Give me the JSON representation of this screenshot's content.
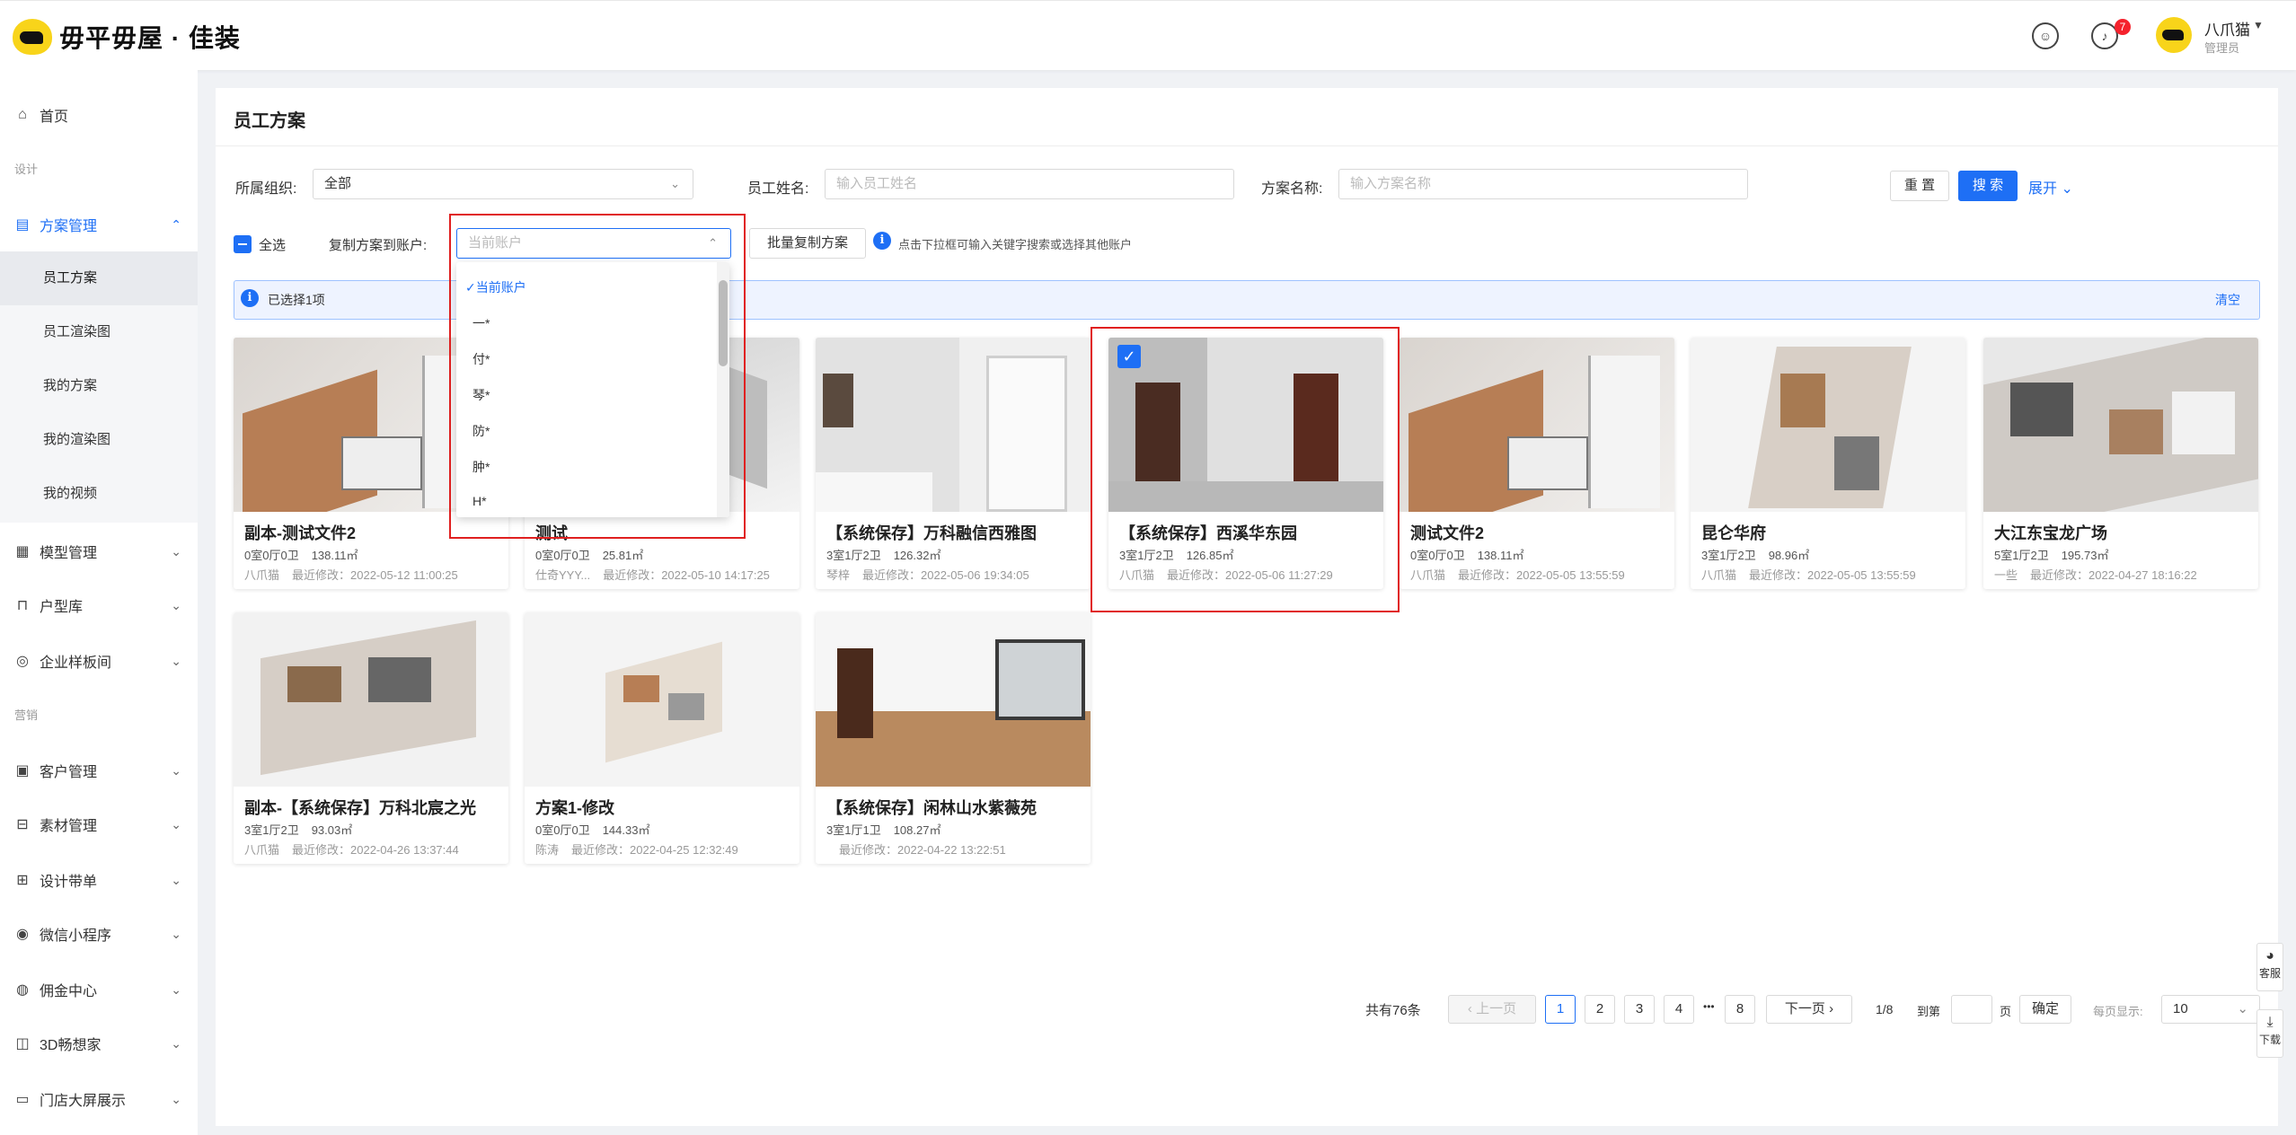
{
  "header": {
    "logo_text": "毋平毋屋 · 佳装",
    "notification_count": "7",
    "user_name": "八爪猫",
    "user_role": "管理员"
  },
  "sidebar": {
    "home": "首页",
    "group_design": "设计",
    "plan_mgmt": "方案管理",
    "sub_items": [
      "员工方案",
      "员工渲染图",
      "我的方案",
      "我的渲染图",
      "我的视频"
    ],
    "model_mgmt": "模型管理",
    "floorplan_lib": "户型库",
    "sample_room": "企业样板间",
    "group_marketing": "营销",
    "items_marketing": [
      "客户管理",
      "素材管理",
      "设计带单",
      "微信小程序",
      "佣金中心",
      "3D畅想家",
      "门店大屏展示"
    ]
  },
  "page": {
    "title": "员工方案",
    "org_label": "所属组织:",
    "org_value": "全部",
    "staff_label": "员工姓名:",
    "staff_placeholder": "输入员工姓名",
    "plan_label": "方案名称:",
    "plan_placeholder": "输入方案名称",
    "reset_btn": "重 置",
    "search_btn": "搜 索",
    "expand_link": "展开",
    "select_all": "全选",
    "copy_label": "复制方案到账户:",
    "account_placeholder": "当前账户",
    "batch_copy_btn": "批量复制方案",
    "hint_text": "点击下拉框可输入关键字搜索或选择其他账户",
    "selected_text": "已选择1项",
    "clear_link": "清空"
  },
  "dropdown": {
    "options": [
      "当前账户",
      "一*",
      "付*",
      "琴*",
      "防*",
      "肿*",
      "H*"
    ]
  },
  "cards": [
    {
      "title": "副本-测试文件2",
      "rooms": "0室0厅0卫",
      "area": "138.11㎡",
      "owner": "八爪猫",
      "modified": "最近修改：2022-05-12 11:00:25",
      "checked": false
    },
    {
      "title": "测试",
      "rooms": "0室0厅0卫",
      "area": "25.81㎡",
      "owner": "仕奇YYY...",
      "modified": "最近修改：2022-05-10 14:17:25",
      "checked": false
    },
    {
      "title": "【系统保存】万科融信西雅图",
      "rooms": "3室1厅2卫",
      "area": "126.32㎡",
      "owner": "琴梓",
      "modified": "最近修改：2022-05-06 19:34:05",
      "checked": false
    },
    {
      "title": "【系统保存】西溪华东园",
      "rooms": "3室1厅2卫",
      "area": "126.85㎡",
      "owner": "八爪猫",
      "modified": "最近修改：2022-05-06 11:27:29",
      "checked": true
    },
    {
      "title": "测试文件2",
      "rooms": "0室0厅0卫",
      "area": "138.11㎡",
      "owner": "八爪猫",
      "modified": "最近修改：2022-05-05 13:55:59",
      "checked": false
    },
    {
      "title": "昆仑华府",
      "rooms": "3室1厅2卫",
      "area": "98.96㎡",
      "owner": "八爪猫",
      "modified": "最近修改：2022-05-05 13:55:59",
      "checked": false
    },
    {
      "title": "大江东宝龙广场",
      "rooms": "5室1厅2卫",
      "area": "195.73㎡",
      "owner": "一些",
      "modified": "最近修改：2022-04-27 18:16:22",
      "checked": false
    },
    {
      "title": "副本-【系统保存】万科北宸之光",
      "rooms": "3室1厅2卫",
      "area": "93.03㎡",
      "owner": "八爪猫",
      "modified": "最近修改：2022-04-26 13:37:44",
      "checked": false
    },
    {
      "title": "方案1-修改",
      "rooms": "0室0厅0卫",
      "area": "144.33㎡",
      "owner": "陈涛",
      "modified": "最近修改：2022-04-25 12:32:49",
      "checked": false
    },
    {
      "title": "【系统保存】闲林山水紫薇苑",
      "rooms": "3室1厅1卫",
      "area": "108.27㎡",
      "owner": "",
      "modified": "最近修改：2022-04-22 13:22:51",
      "checked": false
    }
  ],
  "pagination": {
    "total": "共有76条",
    "prev": "上一页",
    "pages": [
      "1",
      "2",
      "3",
      "4",
      "8"
    ],
    "ellipsis": "•••",
    "next": "下一页",
    "page_ratio": "1/8",
    "goto_label": "到第",
    "page_unit": "页",
    "confirm": "确定",
    "per_page_label": "每页显示:",
    "per_page_value": "10"
  },
  "float": {
    "service": "客服",
    "download": "下载"
  }
}
